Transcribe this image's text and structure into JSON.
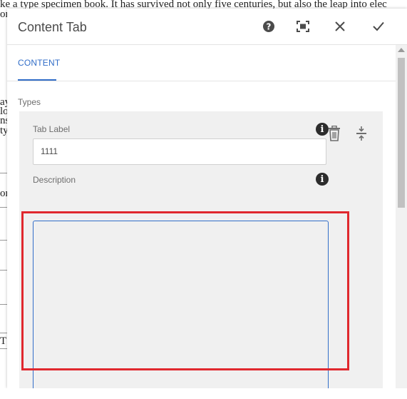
{
  "background": {
    "lines": [
      "ke a type specimen book. It has survived not only five centuries, but also the leap into elec",
      "on"
    ],
    "side_fragments": [
      "ay",
      "lo",
      "ns",
      "ty",
      "on",
      "T"
    ]
  },
  "dialog": {
    "title": "Content Tab",
    "buttons": {
      "help": "help-icon",
      "fullscreen": "fullscreen-icon",
      "close": "close-icon",
      "done": "checkmark-icon"
    },
    "tabs": [
      {
        "label": "CONTENT",
        "active": true
      }
    ],
    "section_label": "Types",
    "multifield_item": {
      "tab_label": {
        "label": "Tab Label",
        "value": "1111"
      },
      "description": {
        "label": "Description",
        "value": ""
      }
    }
  },
  "colors": {
    "accent": "#326ec8",
    "highlight": "#e0282e",
    "panel": "#f0f0f0"
  }
}
